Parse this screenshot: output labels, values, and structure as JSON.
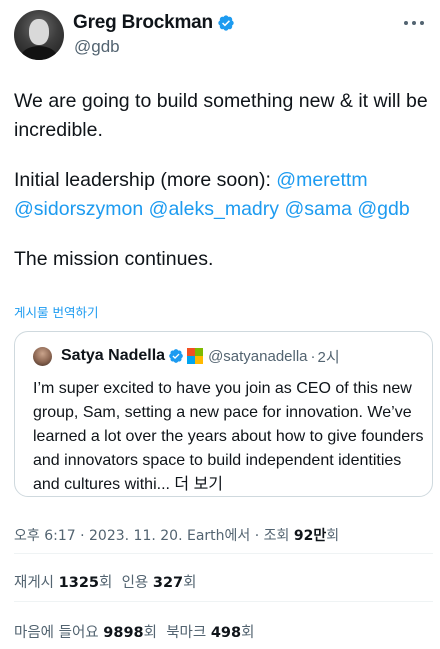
{
  "author": {
    "name": "Greg Brockman",
    "handle": "@gdb",
    "avatar_icon": "profile-photo-greg"
  },
  "tweet": {
    "line1": "We are going to build something new & it will be incredible.",
    "leadership_prefix": "Initial leadership (more soon): ",
    "mentions": [
      "@merettm",
      "@sidorszymon",
      "@aleks_madry",
      "@sama",
      "@gdb"
    ],
    "mission": "The mission continues."
  },
  "translate_label": "게시물 번역하기",
  "quote": {
    "name": "Satya Nadella",
    "handle": "@satyanadella",
    "dot": "·",
    "time": "2시",
    "text": "I’m super excited to have you join as CEO of this new group, Sam, setting a new pace for innovation. We’ve learned a lot over the years about how to give founders and innovators space to build independent identities and cultures withi...",
    "more": " 더 보기"
  },
  "meta": {
    "time": "오후 6:17",
    "sep": " · ",
    "date": "2023. 11. 20.",
    "source": "Earth에서",
    "views_label": "조회 ",
    "views_value": "92만",
    "views_suffix": "회"
  },
  "stats": {
    "reposts_label": "재게시 ",
    "reposts_value": "1325",
    "reposts_suffix": "회",
    "quotes_label": "인용 ",
    "quotes_value": "327",
    "quotes_suffix": "회",
    "likes_label": "마음에 들어요 ",
    "likes_value": "9898",
    "likes_suffix": "회",
    "bookmarks_label": "북마크 ",
    "bookmarks_value": "498",
    "bookmarks_suffix": "회"
  },
  "colors": {
    "accent": "#1d9bf0",
    "text": "#0f1419",
    "muted": "#536471",
    "border": "#cfd9de"
  }
}
